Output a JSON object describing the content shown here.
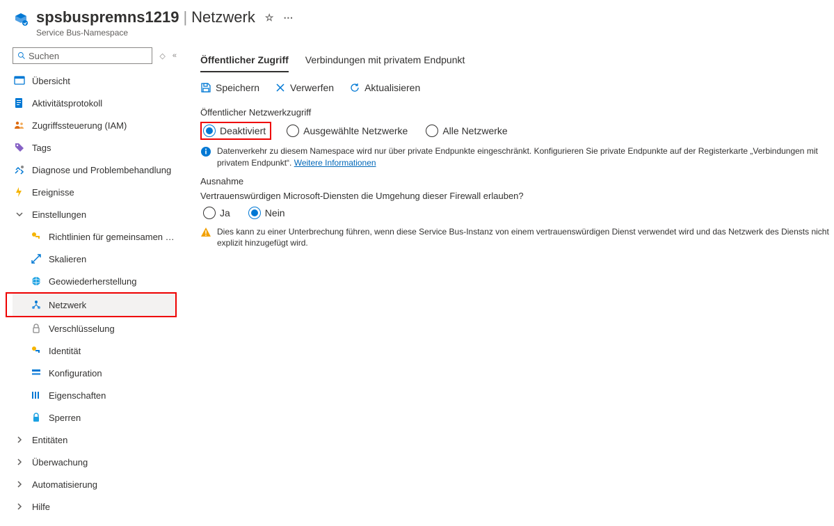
{
  "header": {
    "resource_name": "spsbuspremns1219",
    "section": "Netzwerk",
    "subtitle": "Service Bus-Namespace"
  },
  "search": {
    "placeholder": "Suchen"
  },
  "nav": {
    "ubersicht": "Übersicht",
    "aktivitat": "Aktivitätsprotokoll",
    "iam": "Zugriffssteuerung (IAM)",
    "tags": "Tags",
    "diagnose": "Diagnose und Problembehandlung",
    "ereignisse": "Ereignisse",
    "einstellungen": "Einstellungen",
    "richtlinien": "Richtlinien für gemeinsamen Z...",
    "skalieren": "Skalieren",
    "geo": "Geowiederherstellung",
    "netzwerk": "Netzwerk",
    "verschluesselung": "Verschlüsselung",
    "identitat": "Identität",
    "konfiguration": "Konfiguration",
    "eigenschaften": "Eigenschaften",
    "sperren": "Sperren",
    "entitaten": "Entitäten",
    "ueberwachung": "Überwachung",
    "automatisierung": "Automatisierung",
    "hilfe": "Hilfe"
  },
  "tabs": {
    "public": "Öffentlicher Zugriff",
    "private": "Verbindungen mit privatem Endpunkt"
  },
  "toolbar": {
    "save": "Speichern",
    "discard": "Verwerfen",
    "refresh": "Aktualisieren"
  },
  "content": {
    "public_access_label": "Öffentlicher Netzwerkzugriff",
    "opt_disabled": "Deaktiviert",
    "opt_selected": "Ausgewählte Netzwerke",
    "opt_all": "Alle Netzwerke",
    "info_text": "Datenverkehr zu diesem Namespace wird nur über private Endpunkte eingeschränkt. Konfigurieren Sie private Endpunkte auf der Registerkarte „Verbindungen mit privatem Endpunkt“. ",
    "info_link": "Weitere Informationen",
    "exception_label": "Ausnahme",
    "exception_question": "Vertrauenswürdigen Microsoft-Diensten die Umgehung dieser Firewall erlauben?",
    "opt_yes": "Ja",
    "opt_no": "Nein",
    "warning_text": "Dies kann zu einer Unterbrechung führen, wenn diese Service Bus-Instanz von einem vertrauenswürdigen Dienst verwendet wird und das Netzwerk des Diensts nicht explizit hinzugefügt wird."
  }
}
